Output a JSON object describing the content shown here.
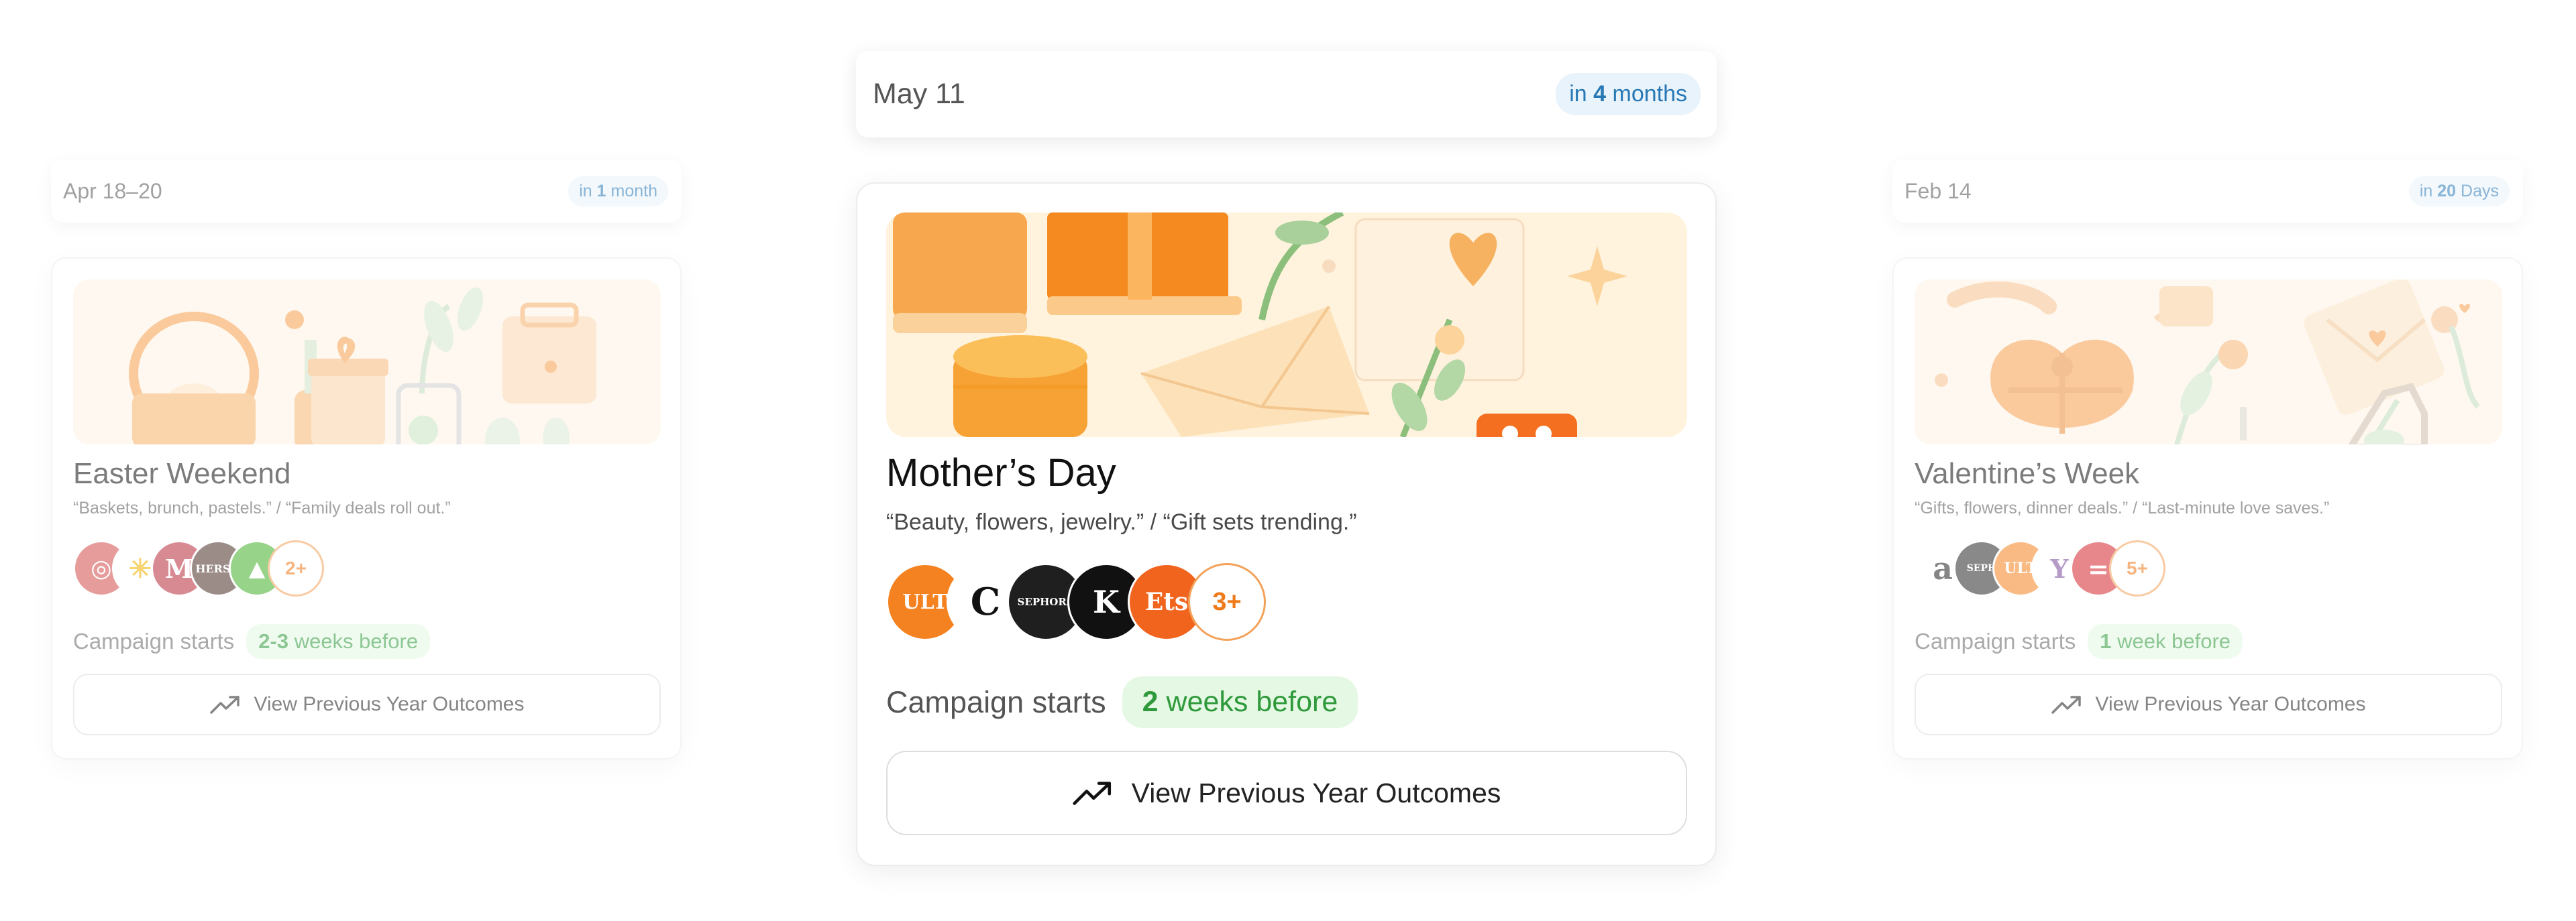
{
  "left_card": {
    "date": "Apr 18–20",
    "countdown_prefix": "in ",
    "countdown_value": "1",
    "countdown_suffix": " month",
    "title": "Easter Weekend",
    "quote": "“Baskets, brunch, pastels.” / “Family deals roll out.”",
    "brands": [
      "Target",
      "Walmart",
      "Macy's",
      "Hershey's",
      "Instacart"
    ],
    "brand_more": "2+",
    "starts_label": "Campaign starts",
    "starts_value": "2-3",
    "starts_suffix": " weeks before",
    "button_label": "View Previous Year Outcomes"
  },
  "center_card": {
    "date": "May 11",
    "countdown_prefix": "in ",
    "countdown_value": "4",
    "countdown_suffix": " months",
    "title": "Mother’s Day",
    "quote": "“Beauty, flowers, jewelry.” / “Gift sets trending.”",
    "brands": [
      "ULTA",
      "Chanel",
      "SEPHORA",
      "Kay",
      "Etsy"
    ],
    "brand_more": "3+",
    "starts_label": "Campaign starts",
    "starts_value": "2",
    "starts_suffix": " weeks before",
    "button_label": "View Previous Year Outcomes"
  },
  "right_card": {
    "date": "Feb 14",
    "countdown_prefix": "in ",
    "countdown_value": "20",
    "countdown_suffix": " Days",
    "title": "Valentine’s Week",
    "quote": "“Gifts, flowers, dinner deals.” / “Last-minute love saves.”",
    "brands": [
      "Amazon",
      "SEPHORA",
      "ULTA",
      "1-800-Flowers",
      "Target"
    ],
    "brand_more": "5+",
    "starts_label": "Campaign starts",
    "starts_value": "1",
    "starts_suffix": " week before",
    "button_label": "View Previous Year Outcomes"
  },
  "colors": {
    "accent_orange": "#ef7a1a",
    "info_blue": "#2878b5",
    "success_green": "#2f9a3b"
  },
  "icons": [
    "trending-up-icon"
  ]
}
